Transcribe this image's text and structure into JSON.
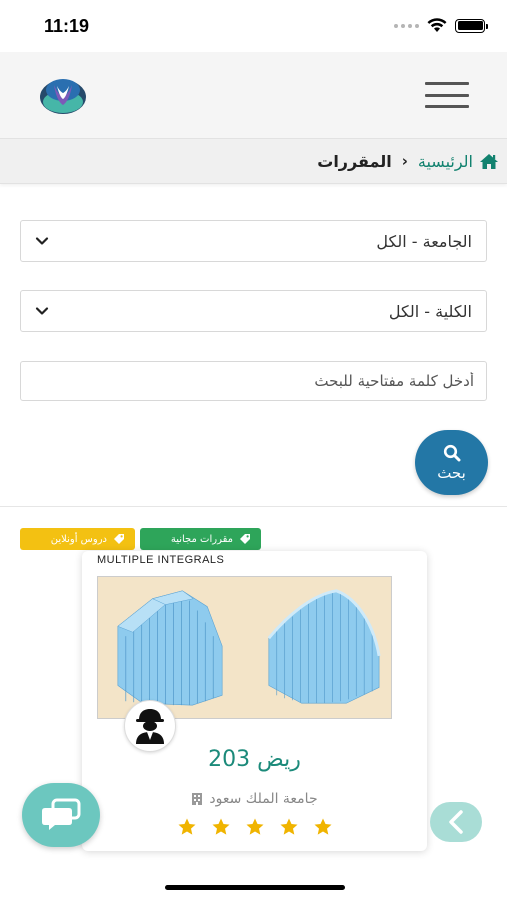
{
  "status_bar": {
    "time": "11:19"
  },
  "breadcrumb": {
    "home": "الرئيسية",
    "current": "المقررات"
  },
  "filters": {
    "university": "الجامعة - الكل",
    "college": "الكلية - الكل",
    "search_placeholder": "أدخل كلمة مفتاحية للبحث",
    "search_button": "بحث"
  },
  "tags": {
    "free": "مقررات مجانية",
    "online": "دروس أونلاين"
  },
  "course": {
    "caption": "MULTIPLE INTEGRALS",
    "title": "ريض 203",
    "university": "جامعة الملك سعود",
    "rating": 5
  },
  "colors": {
    "accent": "#12826f",
    "button": "#2377a6",
    "tag_free": "#2ea55a",
    "tag_online": "#f3c112",
    "star": "#f0b400",
    "chat": "#6cc7bf"
  }
}
